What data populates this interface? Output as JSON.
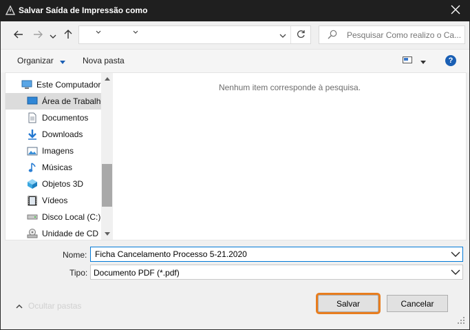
{
  "window": {
    "title": "Salvar Saída de Impressão como",
    "app_icon": "warning-triangle-icon",
    "close_icon": "close-icon"
  },
  "navigation": {
    "back_icon": "arrow-left-icon",
    "forward_icon": "arrow-right-icon",
    "recent_icon": "chevron-down-icon",
    "up_icon": "arrow-up-icon"
  },
  "address_bar": {
    "path": "",
    "refresh_icon": "refresh-icon"
  },
  "search": {
    "placeholder": "Pesquisar Como realizo o Ca...",
    "icon": "search-icon"
  },
  "toolbar": {
    "organize_label": "Organizar",
    "new_folder_label": "Nova pasta",
    "view_icon": "view-options-icon",
    "help_label": "?"
  },
  "nav_pane": {
    "items": [
      {
        "label": "Este Computador",
        "icon": "computer-icon",
        "selected": false
      },
      {
        "label": "Área de Trabalho",
        "icon": "desktop-icon",
        "selected": true
      },
      {
        "label": "Documentos",
        "icon": "documents-icon",
        "selected": false
      },
      {
        "label": "Downloads",
        "icon": "downloads-icon",
        "selected": false
      },
      {
        "label": "Imagens",
        "icon": "pictures-icon",
        "selected": false
      },
      {
        "label": "Músicas",
        "icon": "music-icon",
        "selected": false
      },
      {
        "label": "Objetos 3D",
        "icon": "3d-objects-icon",
        "selected": false
      },
      {
        "label": "Vídeos",
        "icon": "videos-icon",
        "selected": false
      },
      {
        "label": "Disco Local (C:)",
        "icon": "local-disk-icon",
        "selected": false
      },
      {
        "label": "Unidade de CD (",
        "icon": "cd-drive-icon",
        "selected": false
      }
    ]
  },
  "content": {
    "empty_message": "Nenhum item corresponde à pesquisa."
  },
  "form": {
    "name_label": "Nome:",
    "name_value": "Ficha Cancelamento Processo 5-21.2020",
    "type_label": "Tipo:",
    "type_value": "Documento PDF (*.pdf)"
  },
  "footer": {
    "hide_folders_label": "Ocultar pastas",
    "save_label": "Salvar",
    "cancel_label": "Cancelar",
    "save_highlight_color": "#e87d1e"
  }
}
